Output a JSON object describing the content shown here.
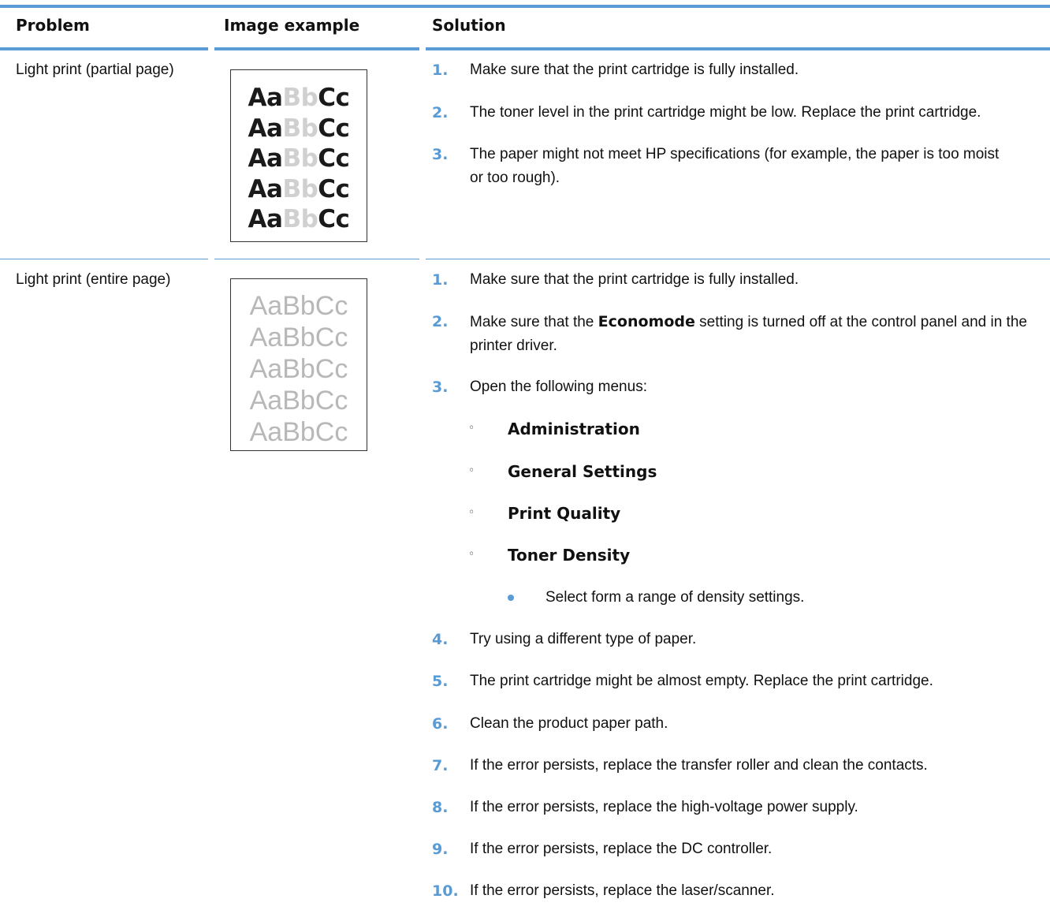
{
  "headers": {
    "problem": "Problem",
    "image_example": "Image example",
    "solution": "Solution"
  },
  "rows": [
    {
      "problem": "Light print (partial page)",
      "sample": {
        "dark1": "Aa",
        "light": "Bb",
        "dark2": "Cc"
      },
      "steps": [
        {
          "n": "1.",
          "text": "Make sure that the print cartridge is fully installed."
        },
        {
          "n": "2.",
          "text": "The toner level in the print cartridge might be low. Replace the print cartridge."
        },
        {
          "n": "3.",
          "text": "The paper might not meet HP specifications (for example, the paper is too moist or too rough)."
        }
      ]
    },
    {
      "problem": "Light print (entire page)",
      "sample": {
        "text": "AaBbCc"
      },
      "steps": [
        {
          "n": "1.",
          "text": "Make sure that the print cartridge is fully installed."
        },
        {
          "n": "2.",
          "pre": "Make sure that the ",
          "bold": "Economode",
          "post": " setting is turned off at the control panel and in the printer driver."
        },
        {
          "n": "3.",
          "text": "Open the following menus:"
        },
        {
          "n": "4.",
          "text": "Try using a different type of paper."
        },
        {
          "n": "5.",
          "text": "The print cartridge might be almost empty. Replace the print cartridge."
        },
        {
          "n": "6.",
          "text": "Clean the product paper path."
        },
        {
          "n": "7.",
          "text": "If the error persists, replace the transfer roller and clean the contacts."
        },
        {
          "n": "8.",
          "text": "If the error persists, replace the high-voltage power supply."
        },
        {
          "n": "9.",
          "text": "If the error persists, replace the DC controller."
        },
        {
          "n": "10.",
          "text": "If the error persists, replace the laser/scanner."
        }
      ],
      "menus": [
        "Administration",
        "General Settings",
        "Print Quality",
        "Toner Density"
      ],
      "menu_bullet": "◦",
      "sub_bullet": "Select form a range of density settings."
    }
  ],
  "colors": {
    "accent": "#5a9bd5"
  }
}
